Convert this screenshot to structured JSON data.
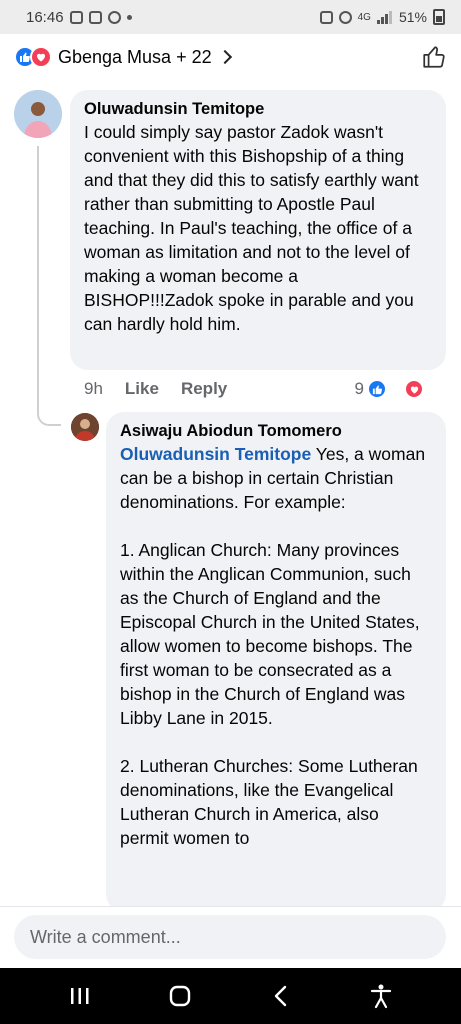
{
  "status_bar": {
    "time": "16:46",
    "network": "4G",
    "battery": "51%"
  },
  "reactions_header": {
    "names": "Gbenga Musa + 22",
    "icons": [
      "like-icon",
      "love-icon"
    ]
  },
  "comments": [
    {
      "author": "Oluwadunsin Temitope",
      "text": "I could simply say pastor Zadok wasn't convenient with this Bishopship of a thing and that they did this to satisfy earthly want rather than submitting to Apostle Paul teaching. In Paul's teaching, the office of a woman as limitation and not to the level of making a woman become a BISHOP!!!Zadok spoke in parable and you can hardly hold him.",
      "time": "9h",
      "like_label": "Like",
      "reply_label": "Reply",
      "reaction_count": "9"
    },
    {
      "author": "Asiwaju Abiodun Tomomero",
      "mention": "Oluwadunsin Temitope",
      "text": " Yes, a woman can be a bishop in certain Christian denominations. For example:\n\n1. Anglican Church: Many provinces within the Anglican Communion, such as the Church of England and the Episcopal Church in the United States, allow women to become bishops. The first woman to be consecrated as a bishop in the Church of England was Libby Lane in 2015.\n\n2. Lutheran Churches: Some Lutheran denominations, like the Evangelical Lutheran Church in America, also permit women to"
    }
  ],
  "composer": {
    "placeholder": "Write a comment..."
  },
  "colors": {
    "accent": "#1877f2",
    "love": "#f33e58",
    "bubble": "#f0f2f5",
    "mention": "#1a5fb4"
  }
}
